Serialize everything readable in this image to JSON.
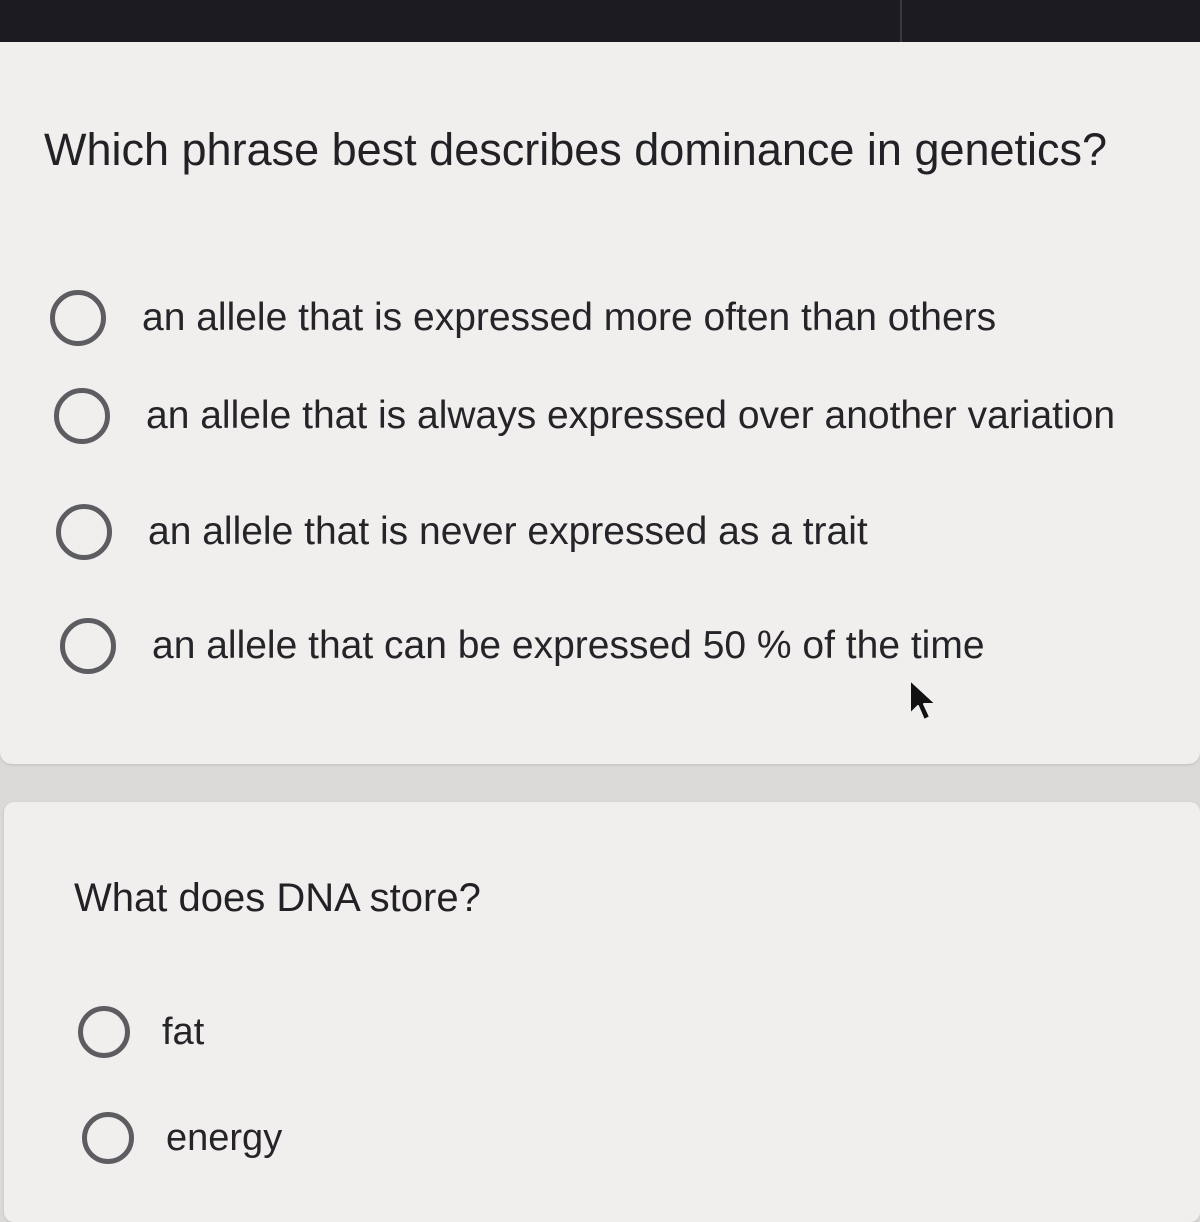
{
  "question1": {
    "title": "Which phrase best describes dominance in genetics?",
    "options": [
      {
        "label": "an allele that is expressed more often than others"
      },
      {
        "label": "an allele that is always expressed over another variation"
      },
      {
        "label": "an allele that is never expressed as a trait"
      },
      {
        "label": "an allele that can be expressed 50 % of the time"
      }
    ]
  },
  "question2": {
    "title": "What does DNA store?",
    "options": [
      {
        "label": "fat"
      },
      {
        "label": "energy"
      }
    ]
  },
  "colors": {
    "page_background": "#dcdad9",
    "card_background": "#f1efee",
    "top_bar": "#1c1b22",
    "radio_border": "#5d5c61",
    "text": "#222125"
  },
  "icons": {
    "radio": "radio-button-unselected-icon",
    "cursor": "mouse-pointer-icon"
  }
}
